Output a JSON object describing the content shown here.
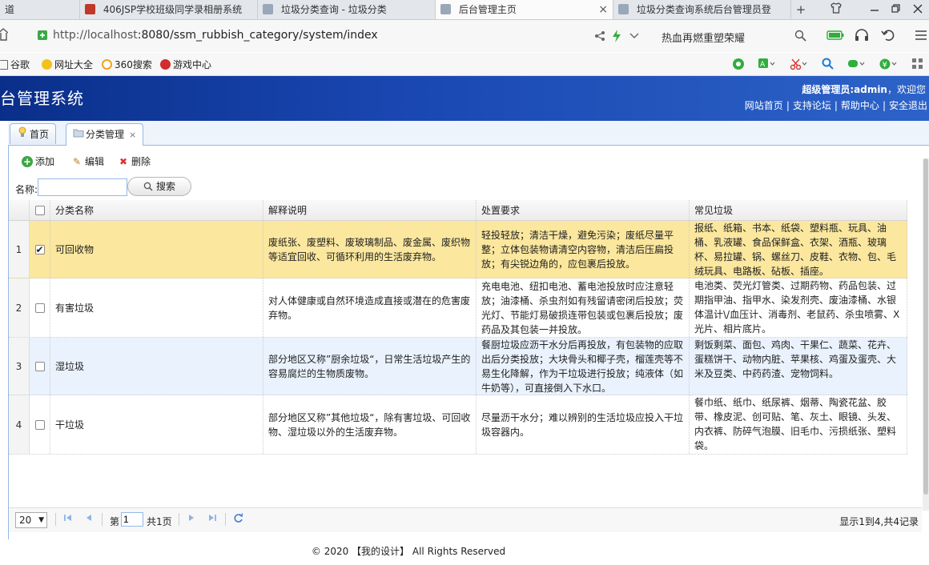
{
  "browser": {
    "tabs": [
      {
        "label": "道",
        "active": false
      },
      {
        "label": "406JSP学校班级同学录相册系统",
        "active": false
      },
      {
        "label": "垃圾分类查询 - 垃圾分类",
        "active": false
      },
      {
        "label": "后台管理主页",
        "active": true
      },
      {
        "label": "垃圾分类查询系统后台管理员登",
        "active": false
      }
    ],
    "close_glyph": "×",
    "new_tab_glyph": "+",
    "url_host": "http://localhost",
    "url_rest": ":8080/ssm_rubbish_category/system/index",
    "hot_search": "热血再燃重塑荣耀",
    "bookmarks": [
      "谷歌",
      "网址大全",
      "360搜索",
      "游戏中心"
    ]
  },
  "header": {
    "title": "台管理系统",
    "welcome_prefix": "超级管理员:admin",
    "welcome_suffix": "，欢迎您",
    "links": [
      "网站首页",
      "支持论坛",
      "帮助中心",
      "安全退出"
    ]
  },
  "tabs": {
    "home": "首页",
    "category": "分类管理",
    "close": "×"
  },
  "toolbar": {
    "add": "添加",
    "edit": "编辑",
    "delete": "删除"
  },
  "search": {
    "label": "名称:",
    "value": "",
    "button": "搜索"
  },
  "grid": {
    "columns": [
      "分类名称",
      "解释说明",
      "处置要求",
      "常见垃圾"
    ],
    "rows": [
      {
        "num": "1",
        "checked": true,
        "name": "可回收物",
        "explain": "废纸张、废塑料、废玻璃制品、废金属、废织物等适宜回收、可循环利用的生活废弃物。",
        "require": "轻投轻放；清洁干燥，避免污染；废纸尽量平整；立体包装物请清空内容物，清洁后压扁投放；有尖锐边角的，应包裹后投放。",
        "common": "报纸、纸箱、书本、纸袋、塑料瓶、玩具、油桶、乳液罐、食品保鲜盒、衣架、酒瓶、玻璃杯、易拉罐、锅、螺丝刀、皮鞋、衣物、包、毛绒玩具、电路板、砧板、插座。"
      },
      {
        "num": "2",
        "checked": false,
        "name": "有害垃圾",
        "explain": "对人体健康或自然环境造成直接或潜在的危害废弃物。",
        "require": "充电电池、纽扣电池、蓄电池投放时应注意轻放；油漆桶、杀虫剂如有残留请密闭后投放；荧光灯、节能灯易破损连带包装或包裹后投放；废药品及其包装一并投放。",
        "common": "电池类、荧光灯管类、过期药物、药品包装、过期指甲油、指甲水、染发剂壳、废油漆桶、水银体温计\\/血压计、消毒剂、老鼠药、杀虫喷雾、X光片、相片底片。"
      },
      {
        "num": "3",
        "checked": false,
        "name": "湿垃圾",
        "explain": "部分地区又称”厨余垃圾“，日常生活垃圾产生的容易腐烂的生物质废物。",
        "require": "餐厨垃圾应沥干水分后再投放，有包装物的应取出后分类投放；大块骨头和椰子壳，榴莲壳等不易生化降解，作为干垃圾进行投放；纯液体（如牛奶等），可直接倒入下水口。",
        "common": "剩饭剩菜、面包、鸡肉、干果仁、蔬菜、花卉、蛋糕饼干、动物内脏、苹果核、鸡蛋及蛋壳、大米及豆类、中药药渣、宠物饲料。"
      },
      {
        "num": "4",
        "checked": false,
        "name": "干垃圾",
        "explain": "部分地区又称”其他垃圾“，除有害垃圾、可回收物、湿垃圾以外的生活废弃物。",
        "require": "尽量沥干水分；难以辨别的生活垃圾应投入干垃圾容器内。",
        "common": "餐巾纸、纸巾、纸尿裤、烟蒂、陶瓷花盆、胶带、橡皮泥、创可贴、笔、灰土、眼镜、头发、内衣裤、防碎气泡膜、旧毛巾、污损纸张、塑料袋。"
      }
    ]
  },
  "pager": {
    "page_size": "20",
    "page_prefix": "第",
    "page_value": "1",
    "page_suffix": "共1页",
    "info": "显示1到4,共4记录"
  },
  "footer": {
    "text": "© 2020 【我的设计】 All Rights Reserved"
  }
}
